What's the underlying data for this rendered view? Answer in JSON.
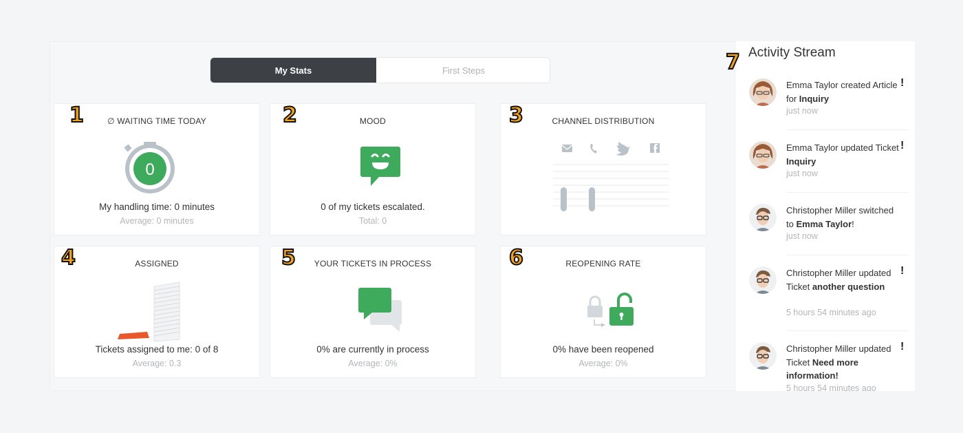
{
  "tabs": {
    "my_stats": "My Stats",
    "first_steps": "First Steps"
  },
  "cards": [
    {
      "badge": "1",
      "title": "∅ WAITING TIME TODAY",
      "stopwatch_value": "0",
      "main": "My handling time: 0 minutes",
      "sub": "Average: 0 minutes"
    },
    {
      "badge": "2",
      "title": "MOOD",
      "main": "0 of my tickets escalated.",
      "sub": "Total: 0"
    },
    {
      "badge": "3",
      "title": "CHANNEL DISTRIBUTION",
      "channels": [
        "email-icon",
        "phone-icon",
        "twitter-icon",
        "facebook-icon"
      ]
    },
    {
      "badge": "4",
      "title": "ASSIGNED",
      "main": "Tickets assigned to me: 0 of 8",
      "sub": "Average: 0.3"
    },
    {
      "badge": "5",
      "title": "YOUR TICKETS IN PROCESS",
      "main": "0% are currently in process",
      "sub": "Average: 0%"
    },
    {
      "badge": "6",
      "title": "REOPENING RATE",
      "main": "0% have been reopened",
      "sub": "Average: 0%"
    }
  ],
  "stream": {
    "badge": "7",
    "title": "Activity Stream",
    "items": [
      {
        "actor": "Emma Taylor",
        "pre": "Emma Taylor created Article for ",
        "bold": "Inquiry",
        "post": "",
        "time": "just now",
        "flag": "!"
      },
      {
        "actor": "Emma Taylor",
        "pre": "Emma Taylor updated Ticket ",
        "bold": "Inquiry",
        "post": "",
        "time": "just now",
        "flag": "!"
      },
      {
        "actor": "Christopher Miller",
        "pre": "Christopher Miller switched to ",
        "bold": "Emma Taylor",
        "post": "!",
        "time": "just now",
        "flag": ""
      },
      {
        "actor": "Christopher Miller",
        "pre": "Christopher Miller updated Ticket ",
        "bold": "another question",
        "post": "",
        "time": "5 hours 54 minutes ago",
        "flag": "!"
      },
      {
        "actor": "Christopher Miller",
        "pre": "Christopher Miller updated Ticket ",
        "bold": "Need more information!",
        "post": "",
        "time": "5 hours 54 minutes ago",
        "flag": "!"
      }
    ]
  },
  "colors": {
    "accent_green": "#3daa5c",
    "dark_tab": "#3d4045",
    "badge_orange": "#f6a313",
    "assigned_orange": "#e8582a"
  }
}
